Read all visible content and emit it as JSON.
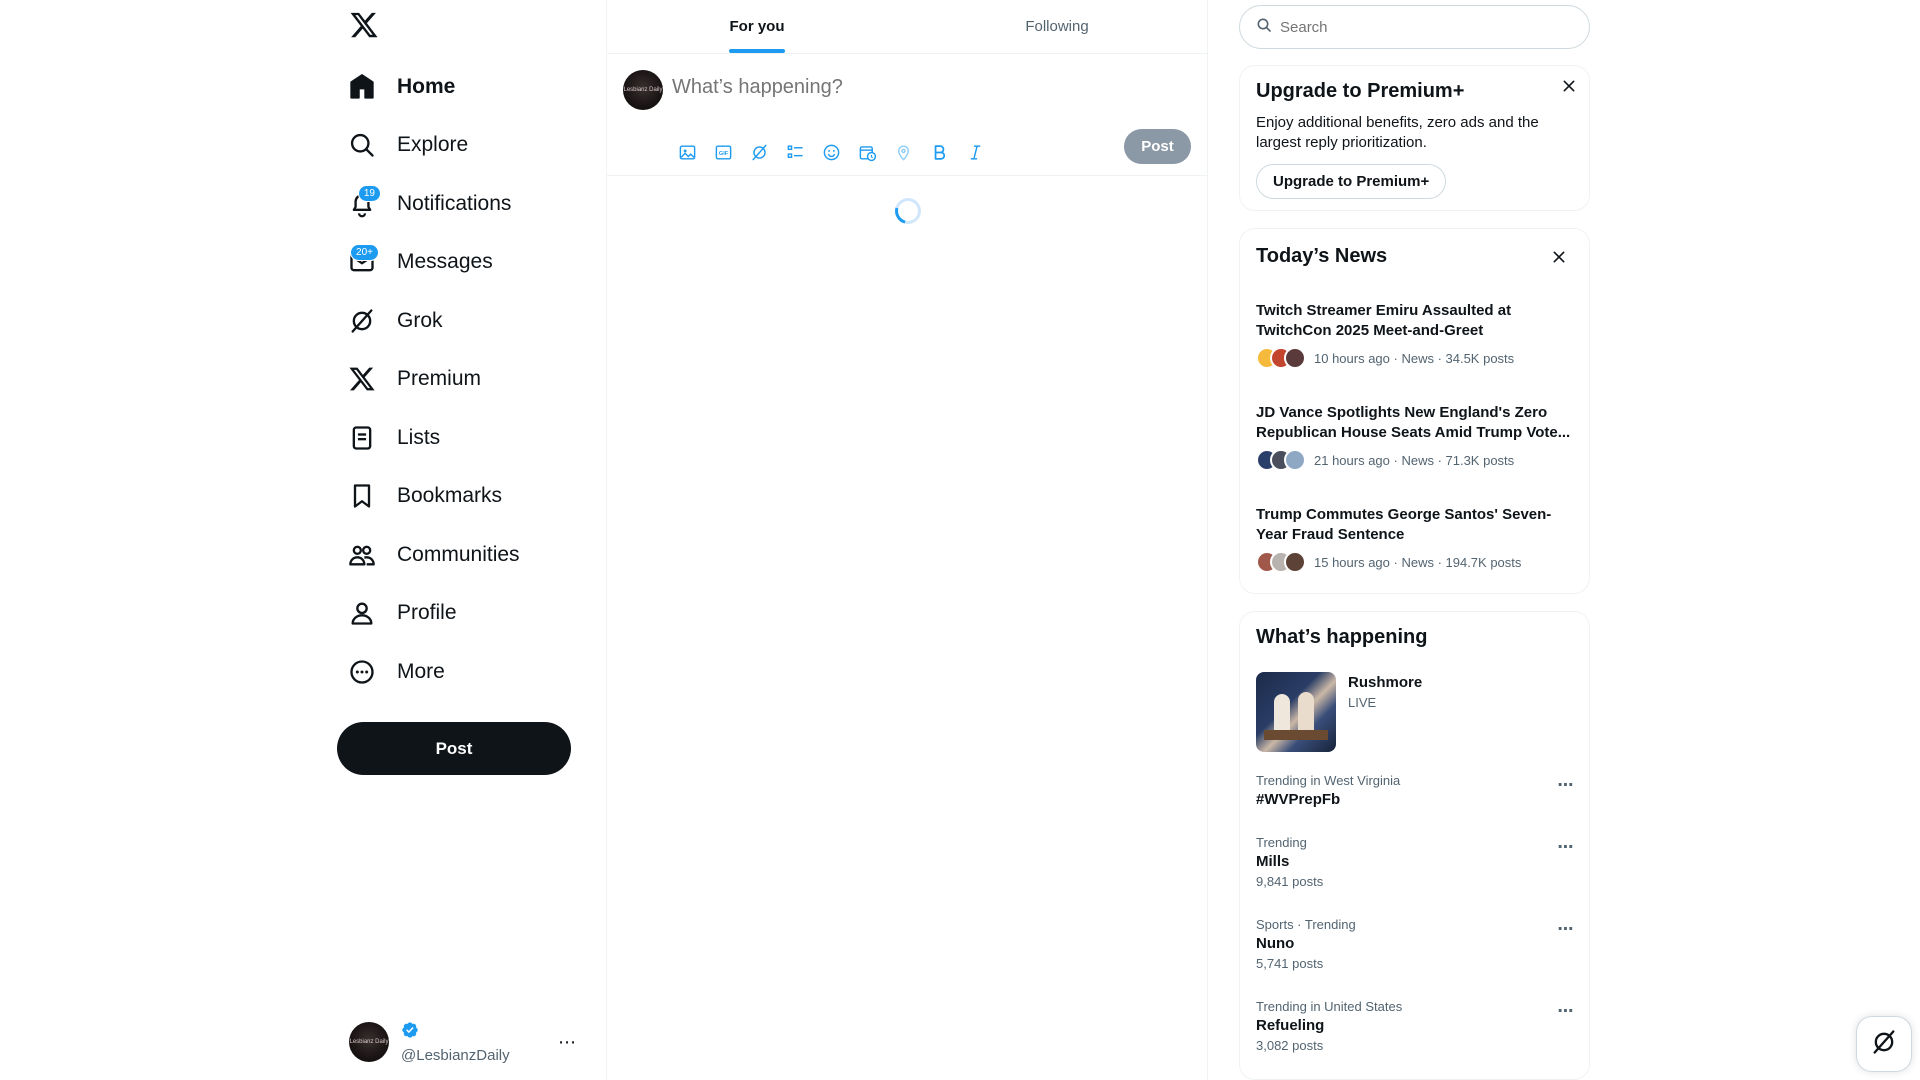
{
  "sidebar": {
    "logo_icon": "x-logo",
    "items": [
      {
        "label": "Home",
        "icon": "home-icon",
        "active": true
      },
      {
        "label": "Explore",
        "icon": "search-icon"
      },
      {
        "label": "Notifications",
        "icon": "bell-icon",
        "badge": "19"
      },
      {
        "label": "Messages",
        "icon": "envelope-icon",
        "badge": "20+"
      },
      {
        "label": "Grok",
        "icon": "grok-icon"
      },
      {
        "label": "Premium",
        "icon": "x-premium-icon"
      },
      {
        "label": "Lists",
        "icon": "list-icon"
      },
      {
        "label": "Bookmarks",
        "icon": "bookmark-icon"
      },
      {
        "label": "Communities",
        "icon": "communities-icon"
      },
      {
        "label": "Profile",
        "icon": "person-icon"
      },
      {
        "label": "More",
        "icon": "more-circle-icon"
      }
    ],
    "post_button": "Post",
    "account": {
      "avatar_text": "Lesbianz Daily",
      "handle": "@LesbianzDaily",
      "more": "⋯"
    }
  },
  "tabs": [
    {
      "label": "For you",
      "active": true
    },
    {
      "label": "Following",
      "active": false
    }
  ],
  "composer": {
    "placeholder": "What’s happening?",
    "tools": [
      "image-icon",
      "gif-icon",
      "grok-icon",
      "poll-icon",
      "emoji-icon",
      "schedule-icon",
      "location-icon",
      "bold-icon",
      "italic-icon"
    ],
    "post_label": "Post"
  },
  "search": {
    "placeholder": "Search"
  },
  "premium": {
    "title": "Upgrade to Premium+",
    "description": "Enjoy additional benefits, zero ads and the largest reply prioritization.",
    "cta": "Upgrade to Premium+"
  },
  "news": {
    "title": "Today’s News",
    "items": [
      {
        "headline": "Twitch Streamer Emiru Assaulted at TwitchCon 2025 Meet-and-Greet",
        "meta": "10 hours ago · News · 34.5K posts"
      },
      {
        "headline": "JD Vance Spotlights New England's Zero Republican House Seats Amid Trump Vote...",
        "meta": "21 hours ago · News · 71.3K posts"
      },
      {
        "headline": "Trump Commutes George Santos' Seven-Year Fraud Sentence",
        "meta": "15 hours ago · News · 194.7K posts"
      }
    ]
  },
  "happening": {
    "title": "What’s happening",
    "live": {
      "name": "Rushmore",
      "status": "LIVE"
    },
    "trends": [
      {
        "context": "Trending in West Virginia",
        "name": "#WVPrepFb",
        "count": ""
      },
      {
        "context": "Trending",
        "name": "Mills",
        "count": "9,841 posts"
      },
      {
        "context": "Sports · Trending",
        "name": "Nuno",
        "count": "5,741 posts"
      },
      {
        "context": "Trending in United States",
        "name": "Refueling",
        "count": "3,082 posts"
      }
    ]
  },
  "colors": {
    "accent": "#1d9bf0",
    "text": "#0f1419",
    "muted": "#536471",
    "border": "#eff3f4"
  }
}
